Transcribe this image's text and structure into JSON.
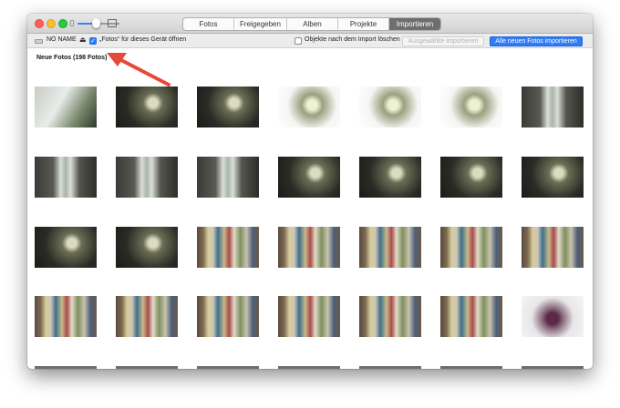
{
  "window": {
    "tabs": [
      {
        "label": "Fotos",
        "active": false
      },
      {
        "label": "Freigegeben",
        "active": false
      },
      {
        "label": "Alben",
        "active": false
      },
      {
        "label": "Projekte",
        "active": false
      },
      {
        "label": "Importieren",
        "active": true
      }
    ]
  },
  "toolbar": {
    "device_name": "NO NAME",
    "open_photos_label": "„Fotos“ für dieses Gerät öffnen",
    "open_photos_checked": true,
    "delete_after_import_label": "Objekte nach dem Import löschen",
    "delete_after_import_checked": false,
    "import_selected_label": "Ausgewählte importieren",
    "import_all_label": "Alle neuen Fotos importieren"
  },
  "section": {
    "title": "Neue Fotos (198 Fotos)"
  },
  "photos": [
    [
      "plant",
      "orchid-dark",
      "orchid-dark",
      "orchid-light",
      "orchid-light",
      "orchid-light",
      "bottle"
    ],
    [
      "bottle",
      "bottle",
      "bottle",
      "orchid-dark",
      "orchid-dark",
      "orchid-dark",
      "orchid-dark"
    ],
    [
      "orchid-dark",
      "orchid-dark",
      "books",
      "books",
      "books",
      "books",
      "books"
    ],
    [
      "books",
      "books",
      "books",
      "books",
      "books",
      "books",
      "flowers"
    ],
    [
      "bottom",
      "bottom",
      "bottom",
      "bottom",
      "bottom",
      "bottom",
      "bottom"
    ]
  ],
  "colors": {
    "accent": "#2f7cf6",
    "annotation_arrow": "#e8483a"
  }
}
